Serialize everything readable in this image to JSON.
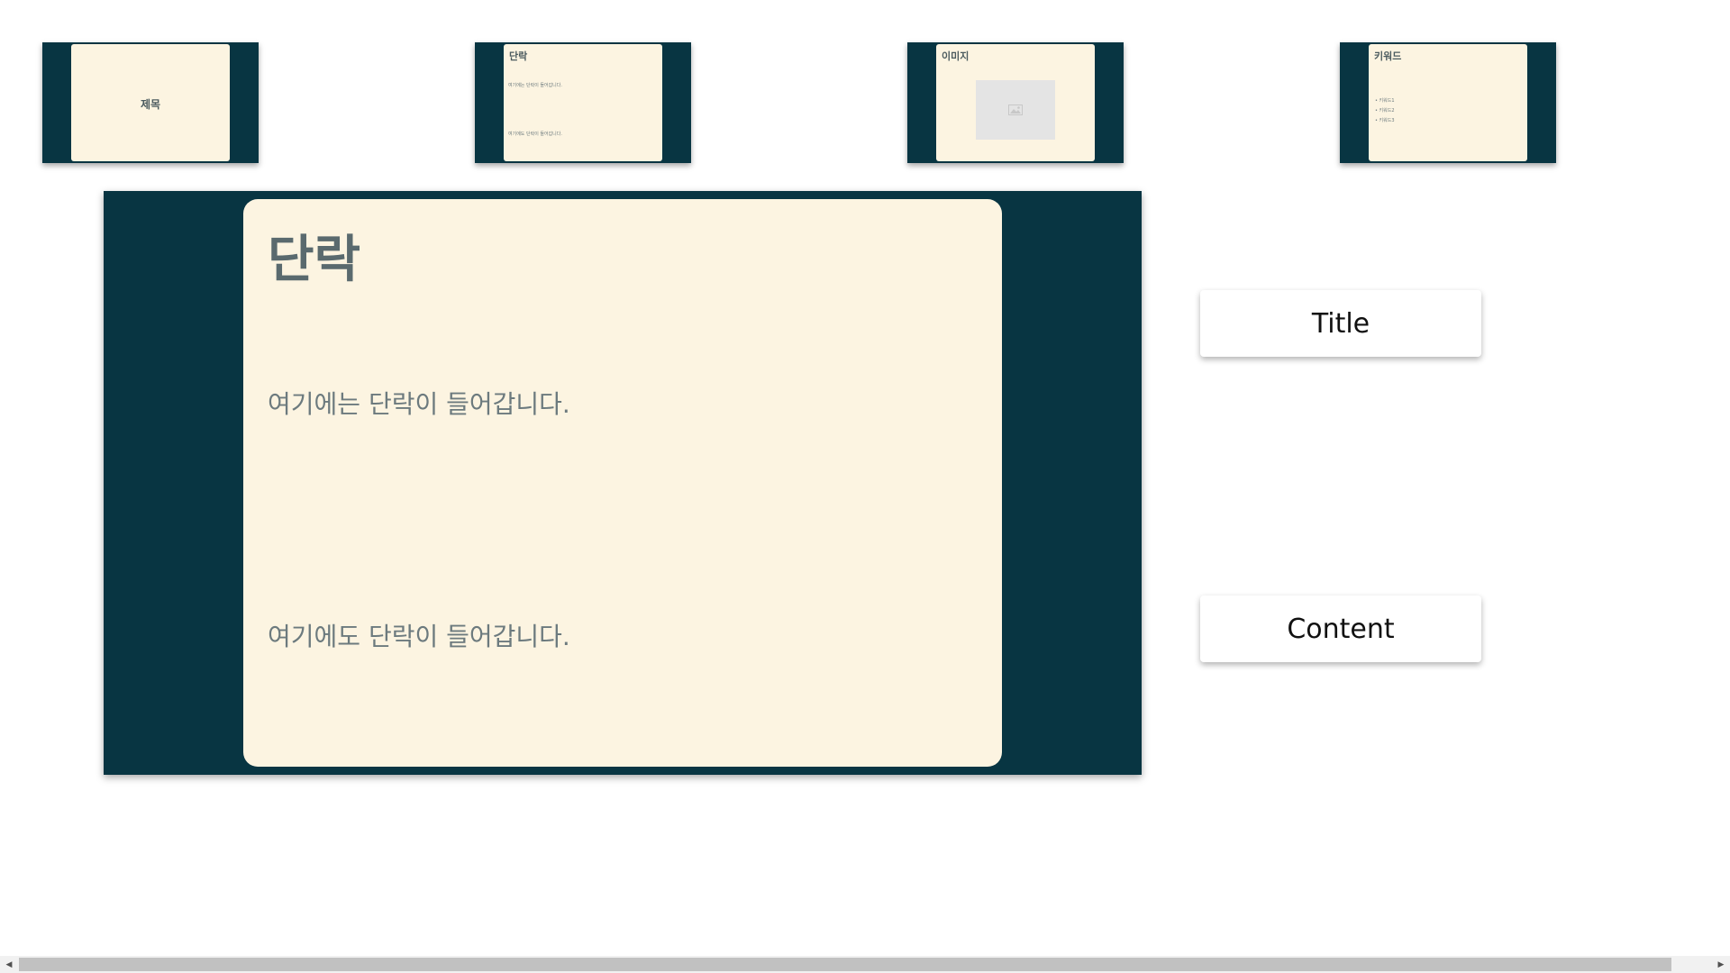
{
  "thumbnails": [
    {
      "type": "title",
      "title": "제목"
    },
    {
      "type": "paragraph",
      "title": "단락",
      "paragraphs": [
        "여기에는 단락이 들어갑니다.",
        "여기에도 단락이 들어갑니다."
      ]
    },
    {
      "type": "image",
      "title": "이미지"
    },
    {
      "type": "keywords",
      "title": "키워드",
      "items": [
        "키워드1",
        "키워드2",
        "키워드3"
      ]
    }
  ],
  "main_slide": {
    "title": "단락",
    "paragraph_1": "여기에는 단락이 들어갑니다.",
    "paragraph_2": "여기에도 단락이 들어갑니다."
  },
  "side_buttons": {
    "title_label": "Title",
    "content_label": "Content"
  },
  "colors": {
    "slide_background": "#083542",
    "card_background": "#fcf4e1",
    "text": "#5a6a6e"
  },
  "scrollbar": {
    "left_arrow": "◀",
    "right_arrow": "▶"
  }
}
